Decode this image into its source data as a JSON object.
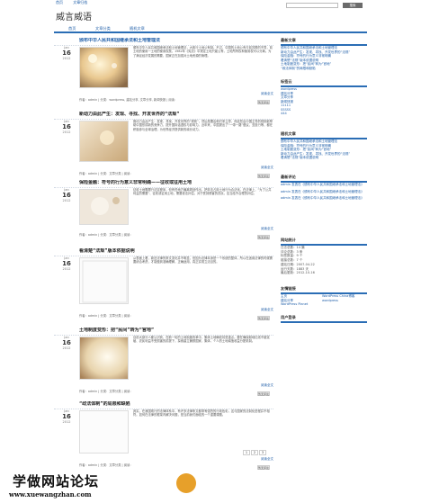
{
  "topbar": {
    "links": [
      "首页",
      "文章归档"
    ]
  },
  "site": {
    "title": "威言威语"
  },
  "search": {
    "placeholder": "",
    "button": "搜索"
  },
  "nav": {
    "items": [
      "首页",
      "文章分类",
      "随机文章"
    ]
  },
  "posts": [
    {
      "title": "颁布中华人民共和国继承法和土地管理法",
      "month": "Jan",
      "day": "16",
      "year": "2012",
      "body": "颁布中华人民共和国继承法和土地管理法，大致行土地公有制。不过，中国的土地公有与前苏联的不同，前土地的使用一土地的使用权属，1982年《宪法》中规定土地只能公有、土地所有权和使用权可以分离。为了满足经济发展的需要，国家正在加强对土地资源的管理。",
      "more": "阅读全文",
      "meta": "作者：admin | 分类：wordpress, 建站分享, 文章分享, 新闻快报 | 阅读：",
      "btn": "暂无评论"
    },
    {
      "title": "新动力由此产生：发现、寻找、开发世界的“法规”",
      "month": "Jan",
      "day": "16",
      "year": "2012",
      "body": "推动力由此产生：发现、寻找、开发世界的“规则”，然后是要由他们来主导，而这些由中国主导的规则能帮助中国形成新的竞争力，提升国际话语权与影响力。近年来，中国提出了“一带一路”倡议，亚投行等，都在积极参与全球治理，为世界经济提供新的增长动力。",
      "more": "阅读全文",
      "meta": "作者：admin | 分类：文章分类 | 阅读：",
      "btn": "暂无评论"
    },
    {
      "title": "保险金融：符号的行为意义非常明确——征收或征用土地",
      "month": "Jan",
      "day": "16",
      "year": "2012",
      "body": "征收土地需履行法定程序，但有些地方偏离规划作出，把非法占用土地行为合法化。在法律上，“为了公共利益的需要”、征收或征用土地，需要依法补偿，对于受到侵害的农民，应当给予合理的补偿。",
      "more": "阅读全文",
      "meta": "作者：admin | 分类：文章分类 | 阅读：",
      "btn": "暂无评论"
    },
    {
      "title": "看清楚“法规”版本依据说明",
      "month": "Jan",
      "day": "16",
      "year": "2012",
      "body": "从表面上看，新旧法律的条文变化并不明显，但因为法律本身是一个系统的整体，所以在适用法律的时候需要综合考虑，才能做到准确理解，正确适用，真正实现立法目的。",
      "more": "阅读全文",
      "meta": "作者：admin | 分类：文章分类 | 阅读：",
      "btn": "暂无评论"
    },
    {
      "title": "土地制度变形：把“民间”转为“官地”",
      "month": "Jan",
      "day": "16",
      "year": "2012",
      "body": "目前大部分人都认识到，在新一轮的土地制度改革中，集体土地确权将是重点。要在确保耕地红线不被突破、农民利益不受损害的前提下，探索建立兼顾国家、集体、个人的土地增值收益分配机制。",
      "more": "阅读全文",
      "meta": "作者：admin | 分类：文章分类 | 阅读：",
      "btn": "暂无评论"
    },
    {
      "title": "“政法体制”的局限和缺陷",
      "month": "Jan",
      "day": "16",
      "year": "2012",
      "body": "其实，在我国现行的法律体系中，有许多法律条文都带有强烈的行政色彩，这与国家的法制化进程并不相符。如何在法律的框架内解决问题，是当前我们面临的一个重要课题。",
      "more": "阅读全文",
      "meta": "作者：admin | 分类：文章分类 | 阅读：",
      "btn": "暂无评论"
    }
  ],
  "pager": [
    "1",
    "2",
    "3"
  ],
  "sidebar": {
    "recent_title": "最新文章",
    "recent": [
      "颁布中华人民共和国继承法和土地管理法",
      "新动力由此产生：发现、寻找、开发世界的“法规”",
      "保险金融：符号的行为意义非常明确",
      "看清楚“法规”版本依据说明",
      "土地制度变形：把“民间”转为“官地”",
      "“政法体制”的局限和缺陷"
    ],
    "tags_title": "标签云",
    "tags": [
      "wordpress",
      "建站分享",
      "文章分享",
      "新闻快报",
      "11111",
      "SSSSS",
      "444"
    ],
    "random_title": "随机文章",
    "comments_title": "最新评论",
    "comments": [
      "admin 发表在《颁布中华人民共和国继承法和土地管理法》",
      "admin 发表在《颁布中华人民共和国继承法和土地管理法》",
      "admin 发表在《颁布中华人民共和国继承法和土地管理法》"
    ],
    "stats_title": "网站统计",
    "stats": [
      "日志总数：14 篇",
      "评论总数：3 条",
      "标签数量：9 个",
      "链接总数：7 个",
      "建站日期：2007-04-22",
      "运行天数：1883 天",
      "最后更新：2012-10-16"
    ],
    "links_title": "友情链接",
    "links": [
      "主页",
      "WordPress China博客",
      "建站分享",
      "wordpress",
      "WordPress Planet"
    ],
    "login_title": "用户登录"
  },
  "watermark": {
    "title": "学做网站论坛",
    "url": "www.xuewangzhan.com"
  }
}
